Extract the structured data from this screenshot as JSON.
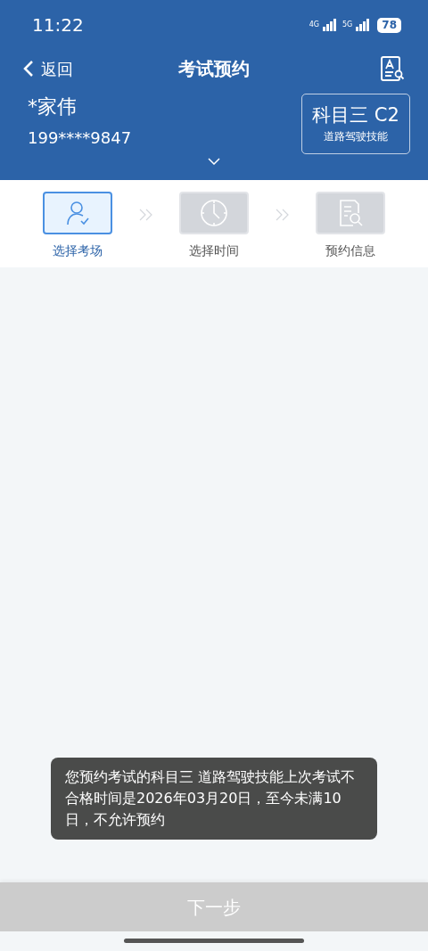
{
  "status_bar": {
    "time": "11:22",
    "network_1": "4G",
    "network_2": "5G",
    "battery": "78"
  },
  "nav": {
    "back": "返回",
    "title": "考试预约"
  },
  "user": {
    "name": "*家伟",
    "phone": "199****9847"
  },
  "subject": {
    "name": "科目三 C2",
    "detail": "道路驾驶技能"
  },
  "steps": [
    {
      "kind": "person",
      "label": "选择考场",
      "selected": true
    },
    {
      "kind": "clock",
      "label": "选择时间",
      "selected": false
    },
    {
      "kind": "document",
      "label": "预约信息",
      "selected": false
    }
  ],
  "toast": "您预约考试的科目三 道路驾驶技能上次考试不合格时间是2026年03月20日，至今未满10日，不允许预约",
  "next_button": {
    "label": "下一步",
    "disabled": true
  }
}
